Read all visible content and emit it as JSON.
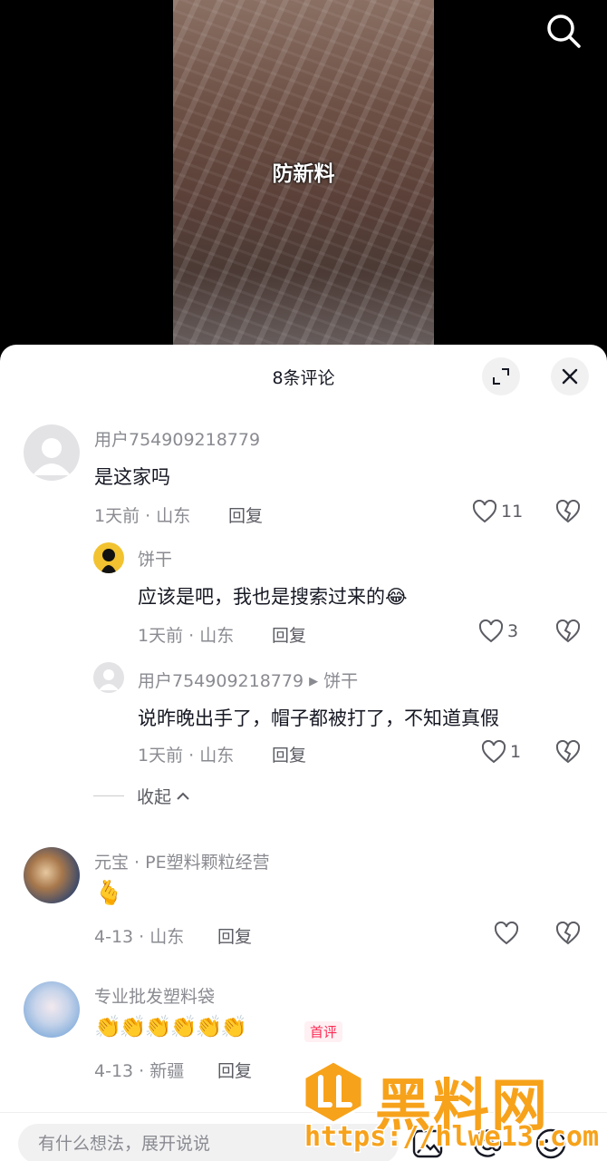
{
  "video": {
    "caption": "防新料"
  },
  "header": {
    "title": "8条评论"
  },
  "comments": [
    {
      "user": "用户754909218779",
      "text": "是这家吗",
      "meta": "1天前 · 山东",
      "reply_label": "回复",
      "likes": "11",
      "replies": [
        {
          "user": "饼干",
          "text": "应该是吧，我也是搜索过来的",
          "emoji": "😂",
          "meta": "1天前 · 山东",
          "reply_label": "回复",
          "likes": "3"
        },
        {
          "user": "用户754909218779",
          "reply_to": "饼干",
          "text": "说昨晚出手了，帽子都被打了，不知道真假",
          "meta": "1天前 · 山东",
          "reply_label": "回复",
          "likes": "1"
        }
      ],
      "collapse_label": "收起"
    },
    {
      "user": "元宝 · PE塑料颗粒经营",
      "text": "🫰",
      "meta": "4-13 · 山东",
      "reply_label": "回复"
    },
    {
      "user": "专业批发塑料袋",
      "text": "👏👏👏👏👏👏",
      "badge": "首评",
      "meta": "4-13 · 新疆",
      "reply_label": "回复"
    }
  ],
  "input": {
    "placeholder": "有什么想法，展开说说"
  },
  "watermark": {
    "title": "黑料网",
    "url": "https://hlwe13.com"
  },
  "colors": {
    "accent": "#fe2c55",
    "watermark": "#f7a21b"
  }
}
